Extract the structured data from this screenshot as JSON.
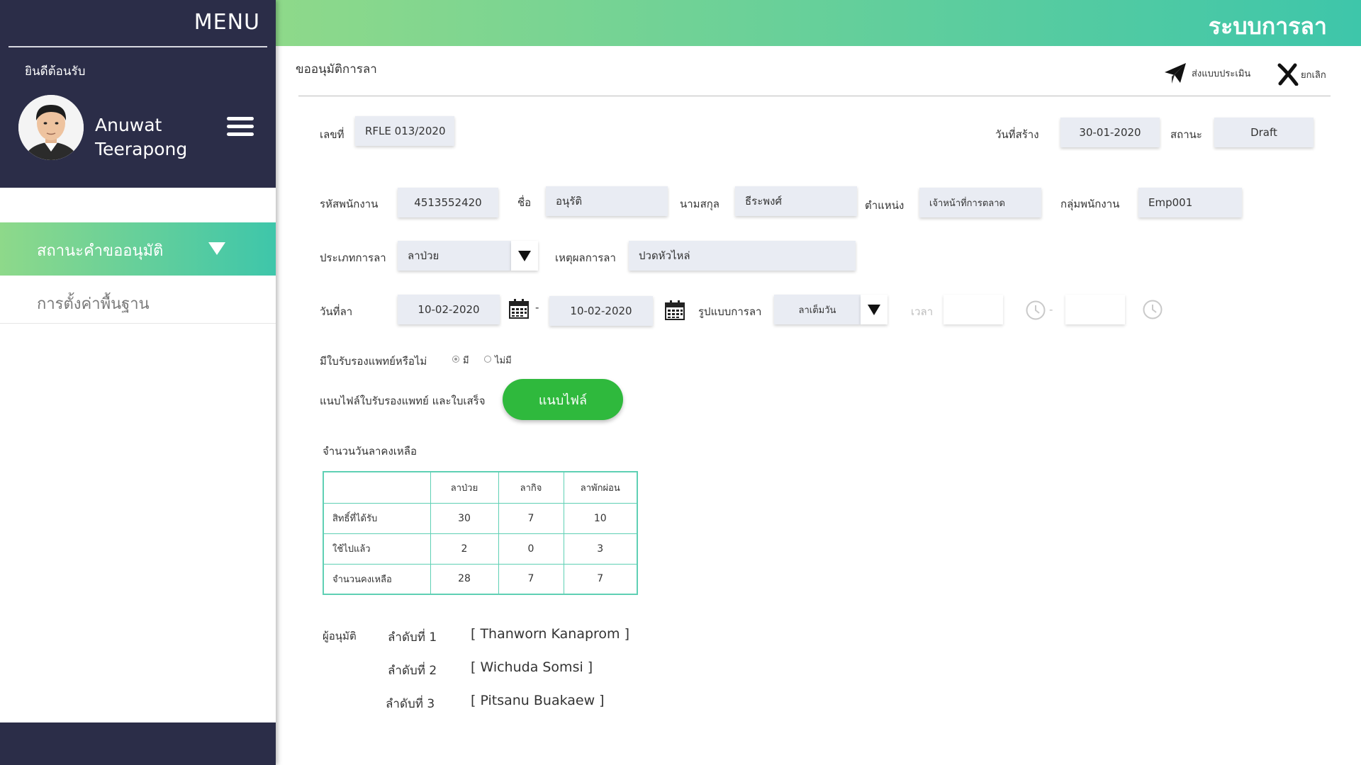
{
  "sidebar": {
    "menu_title": "MENU",
    "welcome": "ยินดีต้อนรับ",
    "user_first": "Anuwat",
    "user_last": "Teerapong",
    "nav_active": "สถานะคำขออนุมัติ",
    "nav_item": "การตั้งค่าพื้นฐาน"
  },
  "header": {
    "app_title": "ระบบการลา"
  },
  "page": {
    "heading": "ขออนุมัติการลา",
    "actions": {
      "submit": "ส่งแบบประเมิน",
      "cancel": "ยกเลิก"
    }
  },
  "form": {
    "doc_no_label": "เลขที่",
    "doc_no": "RFLE 013/2020",
    "created_label": "วันที่สร้าง",
    "created": "30-01-2020",
    "status_label": "สถานะ",
    "status": "Draft",
    "emp_id_label": "รหัสพนักงาน",
    "emp_id": "4513552420",
    "first_name_label": "ชื่อ",
    "first_name": "อนุรัติ",
    "last_name_label": "นามสกุล",
    "last_name": "ธีระพงศ์",
    "position_label": "ตำแหน่ง",
    "position": "เจ้าหน้าที่การตลาด",
    "group_label": "กลุ่มพนักงาน",
    "group": "Emp001",
    "leave_type_label": "ประเภทการลา",
    "leave_type": "ลาป่วย",
    "reason_label": "เหตุผลการลา",
    "reason": "ปวดหัวไหล่",
    "leave_date_label": "วันที่ลา",
    "date_from": "10-02-2020",
    "date_sep": "-",
    "date_to": "10-02-2020",
    "mode_label": "รูปแบบการลา",
    "mode": "ลาเต็มวัน",
    "time_label": "เวลา",
    "time_sep": "-",
    "cert_question": "มีใบรับรองแพทย์หรือไม่",
    "cert_yes": "มี",
    "cert_no": "ไม่มี",
    "attach_label": "แนบไฟล์ใบรับรองแพทย์ และใบเสร็จ",
    "attach_button": "แนบไฟล์"
  },
  "balance": {
    "title": "จำนวนวันลาคงเหลือ",
    "columns": [
      "ลาป่วย",
      "ลากิจ",
      "ลาพักผ่อน"
    ],
    "rows": [
      {
        "label": "สิทธิ์ที่ได้รับ",
        "values": [
          "30",
          "7",
          "10"
        ]
      },
      {
        "label": "ใช้ไปแล้ว",
        "values": [
          "2",
          "0",
          "3"
        ]
      },
      {
        "label": "จำนวนคงเหลือ",
        "values": [
          "28",
          "7",
          "7"
        ]
      }
    ]
  },
  "approvers": {
    "label": "ผู้อนุมัติ",
    "list": [
      {
        "order": "ลำดับที่ 1",
        "name": "[ Thanworn Kanaprom ]"
      },
      {
        "order": "ลำดับที่ 2",
        "name": "[ Wichuda Somsi ]"
      },
      {
        "order": "ลำดับที่ 3",
        "name": "[ Pitsanu Buakaew ]"
      }
    ]
  },
  "colors": {
    "sidebar_dark": "#2b2d48",
    "gradient_start": "#8ed98a",
    "gradient_end": "#3ec6aa",
    "attach_green": "#2fb93d",
    "table_border": "#5fd0b4"
  },
  "icons": [
    "menu-icon",
    "caret-down-icon",
    "paper-plane-icon",
    "cancel-x-icon",
    "calendar-icon",
    "clock-icon",
    "dropdown-arrow-icon"
  ]
}
